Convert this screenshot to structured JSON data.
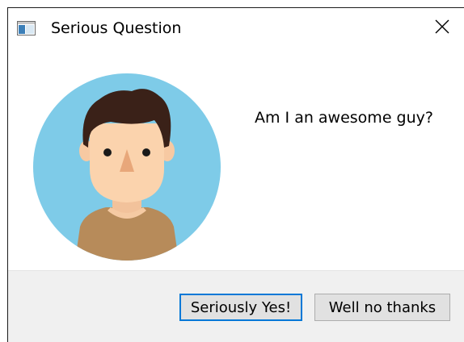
{
  "window": {
    "title": "Serious Question",
    "close_icon": "close-icon",
    "app_icon": "window-app-icon"
  },
  "dialog": {
    "avatar_icon": "avatar-person-icon",
    "message": "Am I an awesome guy?"
  },
  "buttons": {
    "yes_label": "Seriously Yes!",
    "no_label": "Well no thanks"
  },
  "colors": {
    "avatar_background": "#7ecbe8",
    "hair": "#3a2118",
    "skin": "#fbd3ad",
    "nose": "#e8a77a",
    "shirt": "#b78b5a",
    "default_button_border": "#0078d7",
    "button_face": "#e1e1e1",
    "footer_background": "#f0f0f0"
  }
}
